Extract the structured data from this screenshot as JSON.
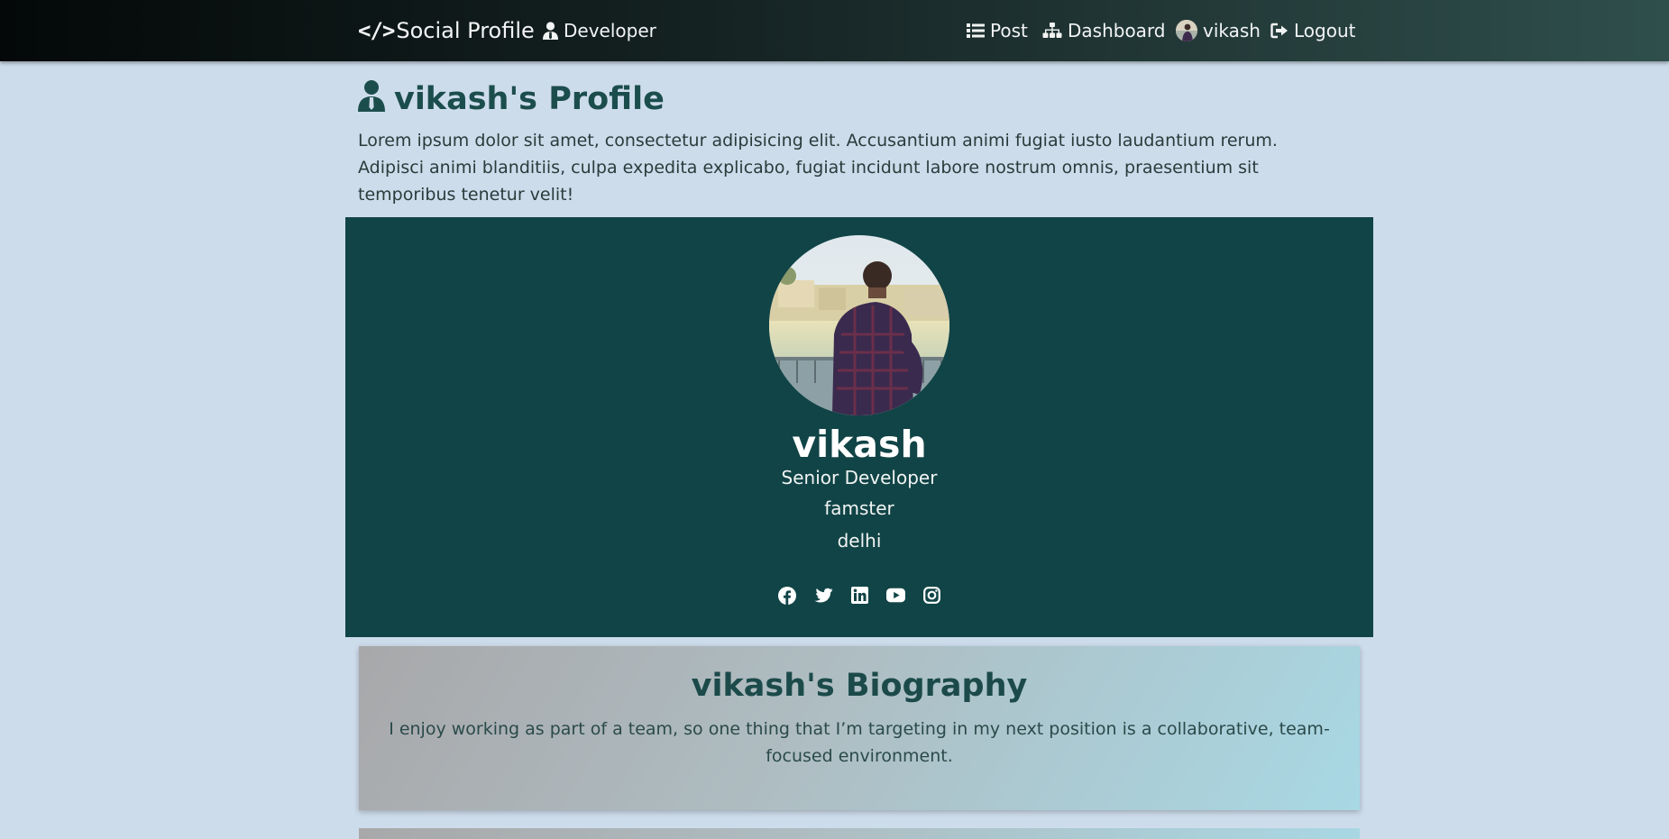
{
  "nav": {
    "brand": "Social Profile",
    "developer": "Developer",
    "post": "Post",
    "dashboard": "Dashboard",
    "user": "vikash",
    "logout": "Logout",
    "icons": {
      "brand": "code-icon",
      "developer": "user-tie-icon",
      "post": "list-icon",
      "dashboard": "sitemap-icon",
      "user": "avatar",
      "logout": "sign-out-icon"
    }
  },
  "header": {
    "title": "vikash's Profile",
    "lead": "Lorem ipsum dolor sit amet, consectetur adipisicing elit. Accusantium animi fugiat iusto laudantium rerum. Adipisci animi blanditiis, culpa expedita explicabo, fugiat incidunt labore nostrum omnis, praesentium sit temporibus tenetur velit!"
  },
  "profile": {
    "name": "vikash",
    "status": "Senior Developer",
    "company": "famster",
    "location": "delhi",
    "social": [
      "facebook-icon",
      "twitter-icon",
      "linkedin-icon",
      "youtube-icon",
      "instagram-icon"
    ]
  },
  "bio": {
    "title": "vikash's Biography",
    "text": "I enjoy working as part of a team, so one thing that I’m targeting in my next position is a collaborative, team-focused environment."
  },
  "colors": {
    "page_bg": "#cddceb",
    "card_bg": "#114446",
    "accent": "#1c4d4d"
  }
}
